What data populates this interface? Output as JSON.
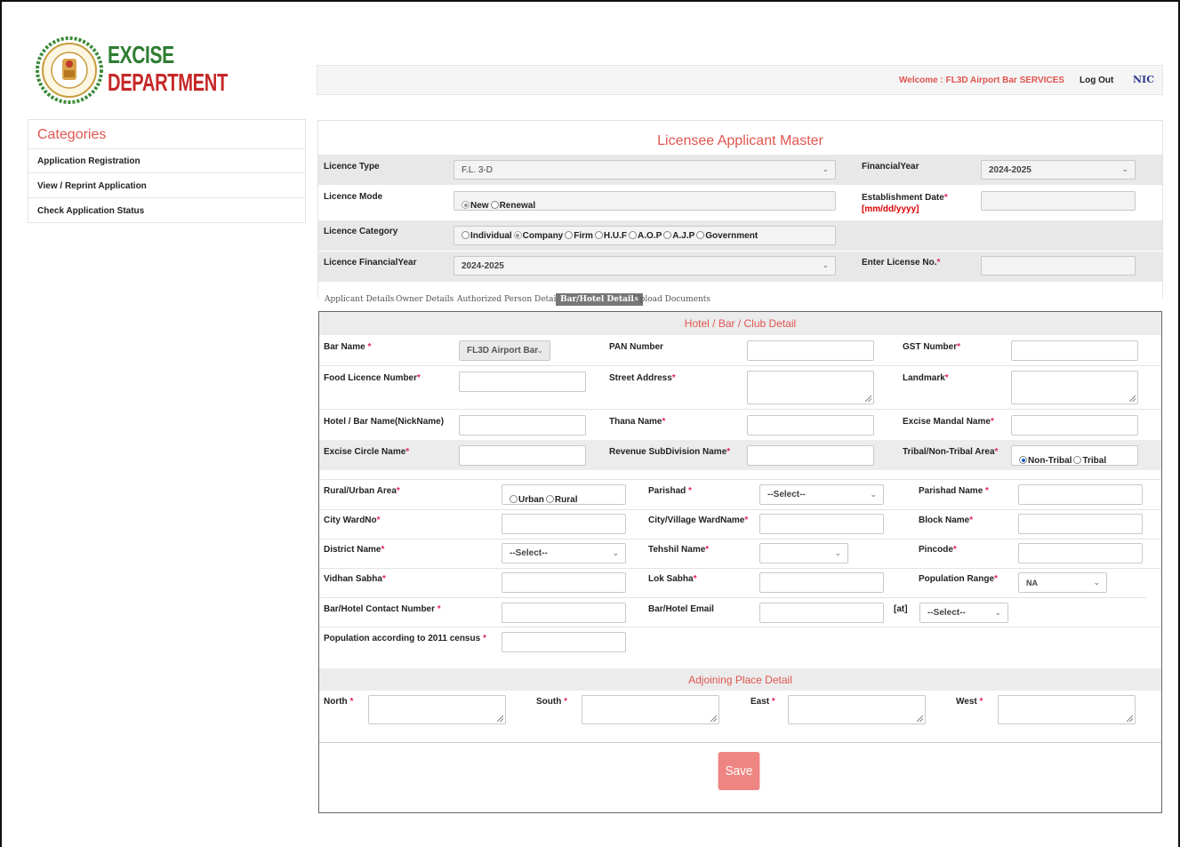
{
  "logo": {
    "line1": "EXCISE",
    "line2": "DEPARTMENT",
    "emblem_icon": "state-emblem-seal"
  },
  "header": {
    "welcome": "Welcome : FL3D Airport Bar SERVICES",
    "logout": "Log Out",
    "nic": "NIC"
  },
  "sidebar": {
    "title": "Categories",
    "items": [
      {
        "label": "Application Registration"
      },
      {
        "label": "View / Reprint Application"
      },
      {
        "label": "Check Application Status"
      }
    ]
  },
  "main": {
    "title": "Licensee Applicant Master",
    "licence_type": {
      "label": "Licence Type",
      "value": "F.L. 3-D"
    },
    "financial_year": {
      "label": "FinancialYear",
      "value": "2024-2025"
    },
    "licence_mode": {
      "label": "Licence Mode",
      "options": [
        "New",
        "Renewal"
      ],
      "selected": "New"
    },
    "establishment_date": {
      "label": "Establishment Date",
      "hint": "[mm/dd/yyyy]",
      "value": ""
    },
    "licence_category": {
      "label": "Licence Category",
      "options": [
        "Individual",
        "Company",
        "Firm",
        "H.U.F",
        "A.O.P",
        "A.J.P",
        "Government"
      ],
      "selected": "Company"
    },
    "licence_financial_year": {
      "label": "Licence FinancialYear",
      "value": "2024-2025"
    },
    "license_no": {
      "label": "Enter License No.",
      "value": ""
    },
    "tabs": [
      {
        "label": "Applicant Details"
      },
      {
        "label": "Owner Details"
      },
      {
        "label": "Authorized Person Details"
      },
      {
        "label": "Bar/Hotel Details",
        "active": true
      },
      {
        "label": "Upload Documents"
      }
    ]
  },
  "hotel": {
    "section_title": "Hotel / Bar / Club Detail",
    "bar_name": {
      "label": "Bar Name",
      "value": "FL3D Airport Bar"
    },
    "pan": {
      "label": "PAN Number",
      "value": ""
    },
    "gst": {
      "label": "GST Number",
      "value": ""
    },
    "food_licence": {
      "label": "Food Licence Number",
      "value": ""
    },
    "street": {
      "label": "Street Address",
      "value": ""
    },
    "landmark": {
      "label": "Landmark",
      "value": ""
    },
    "nickname": {
      "label": "Hotel / Bar Name(NickName)",
      "value": ""
    },
    "thana": {
      "label": "Thana Name",
      "value": ""
    },
    "mandal": {
      "label": "Excise Mandal Name",
      "value": ""
    },
    "circle": {
      "label": "Excise Circle Name",
      "value": ""
    },
    "revenue": {
      "label": "Revenue SubDivision Name",
      "value": ""
    },
    "tribal": {
      "label": "Tribal/Non-Tribal Area",
      "options": [
        "Non-Tribal",
        "Tribal"
      ],
      "selected": "Non-Tribal"
    },
    "rural_urban": {
      "label": "Rural/Urban Area",
      "options": [
        "Urban",
        "Rural"
      ],
      "selected": ""
    },
    "parishad": {
      "label": "Parishad",
      "value": "--Select--"
    },
    "parishad_name": {
      "label": "Parishad Name",
      "value": ""
    },
    "ward_no": {
      "label": "City WardNo",
      "value": ""
    },
    "ward_name": {
      "label": "City/Village WardName",
      "value": ""
    },
    "block": {
      "label": "Block Name",
      "value": ""
    },
    "district": {
      "label": "District Name",
      "value": "--Select--"
    },
    "tehshil": {
      "label": "Tehshil Name",
      "value": ""
    },
    "pincode": {
      "label": "Pincode",
      "value": ""
    },
    "vidhan": {
      "label": "Vidhan Sabha",
      "value": ""
    },
    "lok": {
      "label": "Lok Sabha",
      "value": ""
    },
    "population_range": {
      "label": "Population Range",
      "value": "NA"
    },
    "contact": {
      "label": "Bar/Hotel Contact Number",
      "value": ""
    },
    "email": {
      "label": "Bar/Hotel Email",
      "value": "",
      "at": "[at]",
      "domain": "--Select--"
    },
    "census": {
      "label": "Population according to 2011 census",
      "value": ""
    }
  },
  "adjoining": {
    "section_title": "Adjoining Place Detail",
    "north": "North",
    "south": "South",
    "east": "East",
    "west": "West"
  },
  "save": "Save",
  "colors": {
    "accent_red": "#e0554f",
    "save_bg": "#ee8582",
    "required": "#e0245e",
    "logo_green": "#2e7d32",
    "logo_red": "#c62828"
  }
}
